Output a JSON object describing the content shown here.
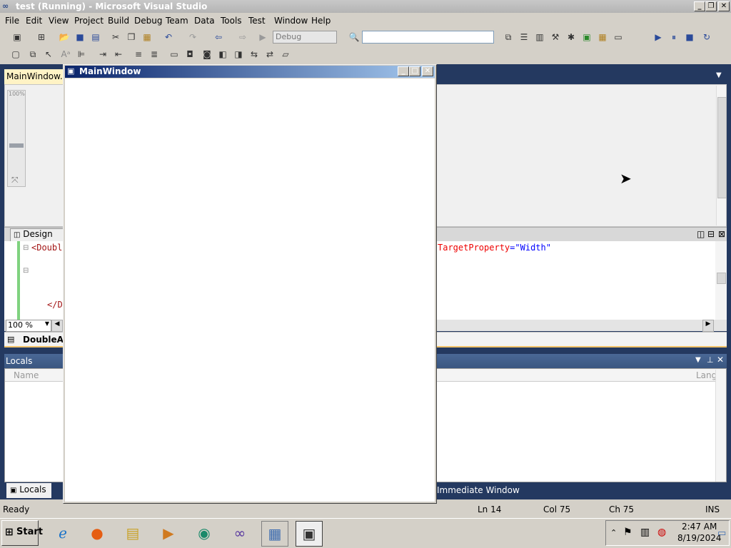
{
  "title_bar": {
    "title": "test (Running) - Microsoft Visual Studio"
  },
  "menu": [
    "File",
    "Edit",
    "View",
    "Project",
    "Build",
    "Debug",
    "Team",
    "Data",
    "Tools",
    "Test",
    "Window",
    "Help"
  ],
  "toolbar": {
    "configuration": "Debug",
    "find_value": ""
  },
  "document": {
    "tab_label": "MainWindow.xaml",
    "zoom_indicator": "100%",
    "design_tab": "Design",
    "xaml_fragment_left": "<Double",
    "xaml_fragment_close": "</D",
    "xaml_attr_name": "TargetProperty",
    "xaml_attr_value": "\"Width\"",
    "xaml_equals": "=",
    "zoom_value": "100 %",
    "breadcrumb": "DoubleAni"
  },
  "locals": {
    "title": "Locals",
    "col_name": "Name",
    "col_lang": "Lang"
  },
  "bottom_tabs": {
    "locals": "Locals",
    "immediate": "Immediate Window"
  },
  "status_bar": {
    "ready": "Ready",
    "ln": "Ln 14",
    "col": "Col 75",
    "ch": "Ch 75",
    "ins": "INS"
  },
  "running_window": {
    "title": "MainWindow"
  },
  "taskbar": {
    "start": "Start",
    "time": "2:47 AM",
    "date": "8/19/2024"
  }
}
